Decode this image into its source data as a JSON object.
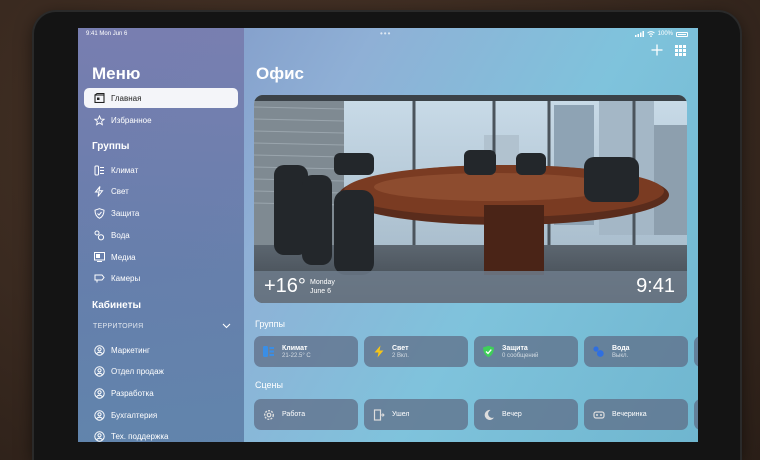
{
  "status": {
    "time": "9:41",
    "date": "Mon Jun 6",
    "dots": "•••",
    "battery": "100%"
  },
  "sidebar": {
    "title": "Меню",
    "main_items": [
      {
        "label": "Главная",
        "icon": "house-icon",
        "active": true
      },
      {
        "label": "Избранное",
        "icon": "star-icon",
        "active": false
      }
    ],
    "groups_header": "Группы",
    "groups": [
      {
        "label": "Климат",
        "icon": "climate-icon"
      },
      {
        "label": "Свет",
        "icon": "bolt-icon"
      },
      {
        "label": "Защита",
        "icon": "shield-icon"
      },
      {
        "label": "Вода",
        "icon": "water-drop-icon"
      },
      {
        "label": "Медиа",
        "icon": "media-icon"
      },
      {
        "label": "Камеры",
        "icon": "camera-icon"
      }
    ],
    "rooms_header": "Кабинеты",
    "territory_label": "ТЕРРИТОРИЯ",
    "rooms": [
      {
        "label": "Маркетинг"
      },
      {
        "label": "Отдел продаж"
      },
      {
        "label": "Разработка"
      },
      {
        "label": "Бухгалтерия"
      },
      {
        "label": "Тех. поддержка"
      }
    ]
  },
  "main": {
    "title": "Офис",
    "hero": {
      "temperature": "+16°",
      "weekday": "Monday",
      "date": "June 6",
      "time": "9:41"
    },
    "groups_label": "Группы",
    "group_tiles": [
      {
        "title": "Климат",
        "subtitle": "21-22.5° C",
        "icon": "climate-icon",
        "color": "#3a8ee6"
      },
      {
        "title": "Свет",
        "subtitle": "2 Вкл.",
        "icon": "bolt-icon",
        "color": "#f5c518"
      },
      {
        "title": "Защита",
        "subtitle": "0 сообщений",
        "icon": "shield-icon",
        "color": "#3fcf5a"
      },
      {
        "title": "Вода",
        "subtitle": "Выкл.",
        "icon": "water-drop-icon",
        "color": "#2f6fe0"
      }
    ],
    "scenes_label": "Сцены",
    "scene_tiles": [
      {
        "title": "Работа",
        "icon": "gear-icon"
      },
      {
        "title": "Ушел",
        "icon": "door-icon"
      },
      {
        "title": "Вечер",
        "icon": "moon-icon"
      },
      {
        "title": "Вечеринка",
        "icon": "party-icon"
      }
    ]
  }
}
